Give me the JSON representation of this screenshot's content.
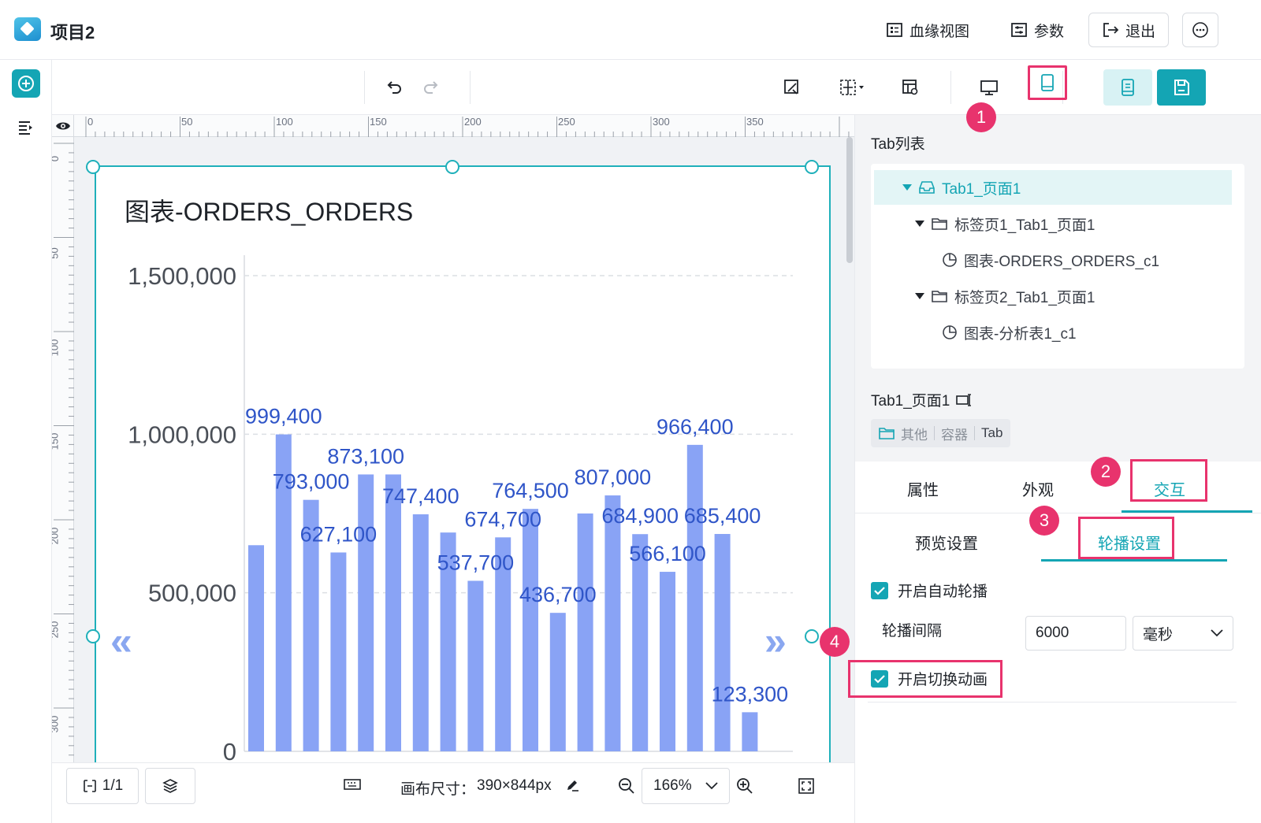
{
  "header": {
    "title": "项目2",
    "lineage_label": "血缘视图",
    "params_label": "参数",
    "exit_label": "退出"
  },
  "canvas": {
    "ruler_x": [
      "0",
      "50",
      "100",
      "150",
      "200",
      "250",
      "300",
      "350"
    ],
    "ruler_y": [
      "0",
      "50",
      "100",
      "150",
      "200",
      "250",
      "300"
    ]
  },
  "chart": {
    "title": "图表-ORDERS_ORDERS",
    "nav_prev": "«",
    "nav_next": "»"
  },
  "chart_data": {
    "type": "bar",
    "title": "图表-ORDERS_ORDERS",
    "ylim": [
      0,
      1500000
    ],
    "yticks": [
      {
        "value": 0,
        "label": "0"
      },
      {
        "value": 500000,
        "label": "500,000"
      },
      {
        "value": 1000000,
        "label": "1,000,000"
      },
      {
        "value": 1500000,
        "label": "1,500,000"
      }
    ],
    "grid": true,
    "values": [
      650000,
      999400,
      793000,
      627100,
      873100,
      873100,
      747400,
      690000,
      537700,
      674700,
      764500,
      436700,
      750000,
      807000,
      684900,
      566100,
      966400,
      685400,
      123300
    ],
    "labels": [
      "",
      "999,400",
      "793,000",
      "627,100",
      "873,100",
      "",
      "747,400",
      "",
      "537,700",
      "674,700",
      "764,500",
      "436,700",
      "",
      "807,000",
      "684,900",
      "566,100",
      "966,400",
      "685,400",
      "123,300"
    ],
    "color": "#89a3f5",
    "label_color": "#2f55c8"
  },
  "bottom": {
    "pages": "1/1",
    "canvas_size_label": "画布尺寸：",
    "canvas_size_value": "390×844px",
    "zoom": "166%"
  },
  "panel": {
    "tab_list_title": "Tab列表",
    "tree": [
      {
        "label": "Tab1_页面1"
      },
      {
        "label": "标签页1_Tab1_页面1"
      },
      {
        "label": "图表-ORDERS_ORDERS_c1"
      },
      {
        "label": "标签页2_Tab1_页面1"
      },
      {
        "label": "图表-分析表1_c1"
      }
    ],
    "component_name": "Tab1_页面1",
    "tags": [
      "其他",
      "容器",
      "Tab"
    ],
    "tabs": [
      "属性",
      "外观",
      "交互"
    ],
    "subtabs": [
      "预览设置",
      "轮播设置"
    ],
    "auto_carousel_label": "开启自动轮播",
    "interval_label": "轮播间隔",
    "interval_value": "6000",
    "interval_unit": "毫秒",
    "animation_label": "开启切换动画"
  },
  "annotations": [
    "1",
    "2",
    "3",
    "4"
  ],
  "colors": {
    "accent": "#14a5b4",
    "highlight": "#e8336d",
    "bar": "#89a3f5"
  }
}
